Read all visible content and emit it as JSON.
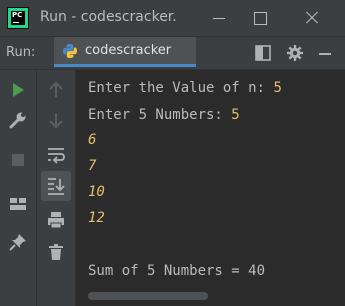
{
  "window": {
    "title": "Run - codescracker.",
    "logo_text": "PC"
  },
  "run_panel": {
    "label": "Run:",
    "tab_label": "codescracker",
    "icons": [
      "layout-icon",
      "gear-icon",
      "hide-panel-icon"
    ]
  },
  "left_toolbar": {
    "icons": [
      "run-icon",
      "wrench-icon",
      "stop-icon",
      "layout-icon",
      "pin-icon"
    ]
  },
  "second_toolbar": {
    "icons": [
      "up-arrow-icon",
      "down-arrow-icon",
      "soft-wrap-icon",
      "scroll-to-end-icon",
      "print-icon",
      "trash-icon"
    ]
  },
  "console": {
    "lines": [
      {
        "prompt": "Enter the Value of n: ",
        "input": "5"
      },
      {
        "prompt": "Enter 5 Numbers: ",
        "input": "5"
      },
      {
        "prompt": "",
        "input": "6"
      },
      {
        "prompt": "",
        "input": "7"
      },
      {
        "prompt": "",
        "input": "10"
      },
      {
        "prompt": "",
        "input": "12"
      },
      {
        "prompt": "",
        "input": ""
      },
      {
        "prompt": "Sum of 5 Numbers = 40",
        "input": ""
      }
    ]
  },
  "colors": {
    "background": "#2b2b2b",
    "panel": "#3c3f41",
    "input_text": "#e8bf6a",
    "output_text": "#bbbbbb",
    "run_green": "#499c54",
    "tab_underline": "#4a88c7"
  }
}
